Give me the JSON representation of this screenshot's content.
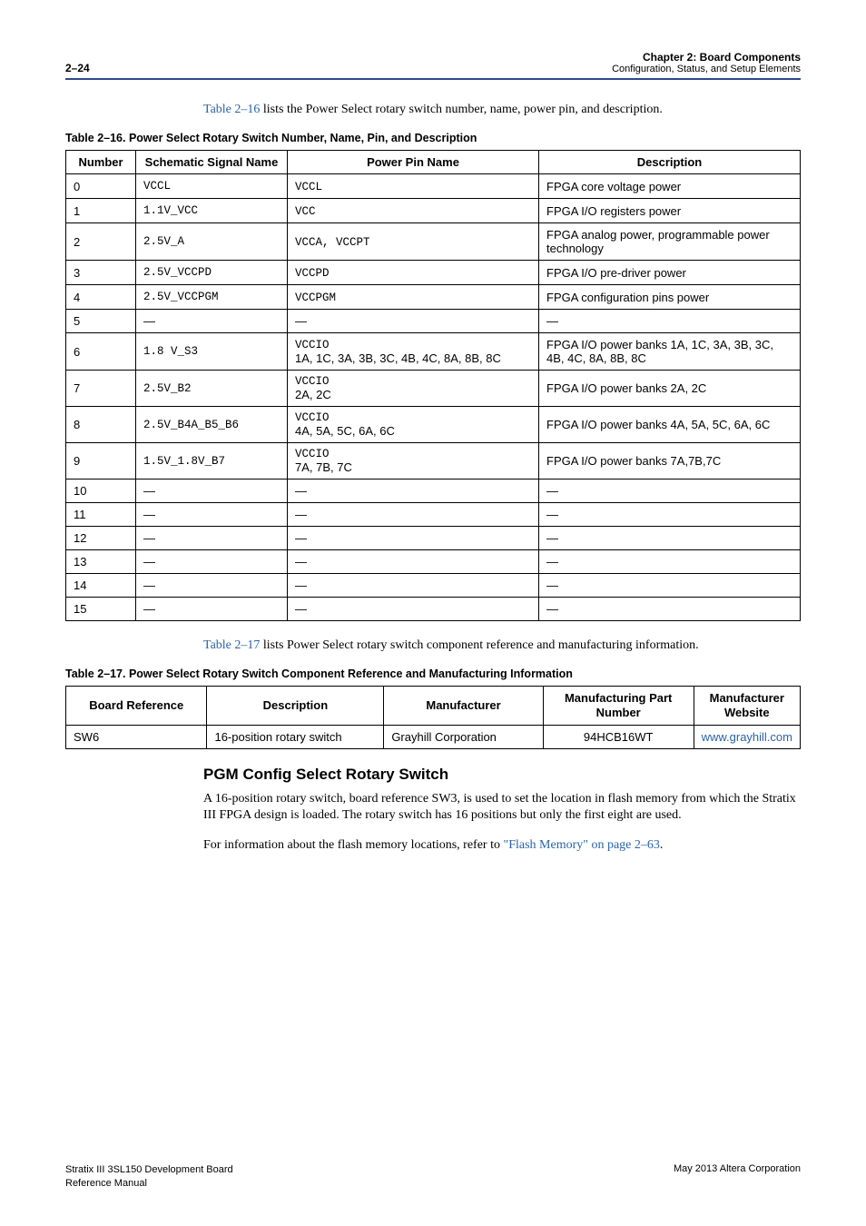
{
  "header": {
    "page_num": "2–24",
    "chapter": "Chapter 2: Board Components",
    "section": "Configuration, Status, and Setup Elements"
  },
  "intro_para": {
    "link": "Table 2–16",
    "rest": " lists the Power Select rotary switch number, name, power pin, and description."
  },
  "table16": {
    "caption": "Table 2–16.  Power Select Rotary Switch Number, Name, Pin, and Description",
    "headers": {
      "number": "Number",
      "schematic": "Schematic Signal Name",
      "pin": "Power Pin Name",
      "desc": "Description"
    },
    "rows": [
      {
        "num": "0",
        "sig": "VCCL",
        "pin": "VCCL",
        "desc": "FPGA core voltage power"
      },
      {
        "num": "1",
        "sig": "1.1V_VCC",
        "pin": "VCC",
        "desc": "FPGA I/O registers power"
      },
      {
        "num": "2",
        "sig": "2.5V_A",
        "pin": "VCCA, VCCPT",
        "desc": "FPGA analog power, programmable power technology"
      },
      {
        "num": "3",
        "sig": "2.5V_VCCPD",
        "pin": "VCCPD",
        "desc": "FPGA I/O pre-driver power"
      },
      {
        "num": "4",
        "sig": "2.5V_VCCPGM",
        "pin": "VCCPGM",
        "desc": "FPGA configuration pins power"
      },
      {
        "num": "5",
        "sig": "—",
        "pin": "—",
        "desc": "—",
        "dash": true
      },
      {
        "num": "6",
        "sig": "1.8 V_S3",
        "pin1": "VCCIO",
        "pin2": "1A, 1C, 3A, 3B, 3C, 4B, 4C, 8A, 8B, 8C",
        "desc": "FPGA I/O power banks 1A, 1C, 3A, 3B, 3C, 4B, 4C, 8A, 8B, 8C",
        "twoline": true
      },
      {
        "num": "7",
        "sig": "2.5V_B2",
        "pin1": "VCCIO",
        "pin2": "2A, 2C",
        "desc": "FPGA I/O power banks 2A, 2C",
        "twoline": true
      },
      {
        "num": "8",
        "sig": "2.5V_B4A_B5_B6",
        "pin1": "VCCIO",
        "pin2": "4A, 5A, 5C, 6A, 6C",
        "desc": "FPGA I/O power banks 4A, 5A, 5C, 6A, 6C",
        "twoline": true
      },
      {
        "num": "9",
        "sig": "1.5V_1.8V_B7",
        "pin1": "VCCIO",
        "pin2": "7A, 7B, 7C",
        "desc": "FPGA I/O power banks 7A,7B,7C",
        "twoline": true
      },
      {
        "num": "10",
        "sig": "—",
        "pin": "—",
        "desc": "—",
        "dash": true
      },
      {
        "num": "11",
        "sig": "—",
        "pin": "—",
        "desc": "—",
        "dash": true
      },
      {
        "num": "12",
        "sig": "—",
        "pin": "—",
        "desc": "—",
        "dash": true
      },
      {
        "num": "13",
        "sig": "—",
        "pin": "—",
        "desc": "—",
        "dash": true
      },
      {
        "num": "14",
        "sig": "—",
        "pin": "—",
        "desc": "—",
        "dash": true
      },
      {
        "num": "15",
        "sig": "—",
        "pin": "—",
        "desc": "—",
        "dash": true
      }
    ]
  },
  "mid_para": {
    "link": "Table 2–17",
    "rest": " lists Power Select rotary switch component reference and manufacturing information."
  },
  "table17": {
    "caption": "Table 2–17.  Power Select Rotary Switch Component Reference and Manufacturing Information",
    "headers": {
      "ref": "Board Reference",
      "desc": "Description",
      "mfr": "Manufacturer",
      "part": "Manufacturing Part Number",
      "site": "Manufacturer Website"
    },
    "row": {
      "ref": "SW6",
      "desc": "16-position rotary switch",
      "mfr": "Grayhill Corporation",
      "part": "94HCB16WT",
      "site": "www.grayhill.com"
    }
  },
  "section2": {
    "heading": "PGM Config Select Rotary Switch",
    "para1": "A 16-position rotary switch, board reference SW3, is used to set the location in flash memory from which the Stratix III FPGA design is loaded. The rotary switch has 16 positions but only the first eight are used.",
    "para2_pre": "For information about the flash memory locations, refer to ",
    "para2_link": "\"Flash Memory\" on page 2–63",
    "para2_post": "."
  },
  "footer": {
    "left1": "Stratix III 3SL150 Development Board",
    "left2": "Reference Manual",
    "right": "May 2013   Altera Corporation"
  }
}
